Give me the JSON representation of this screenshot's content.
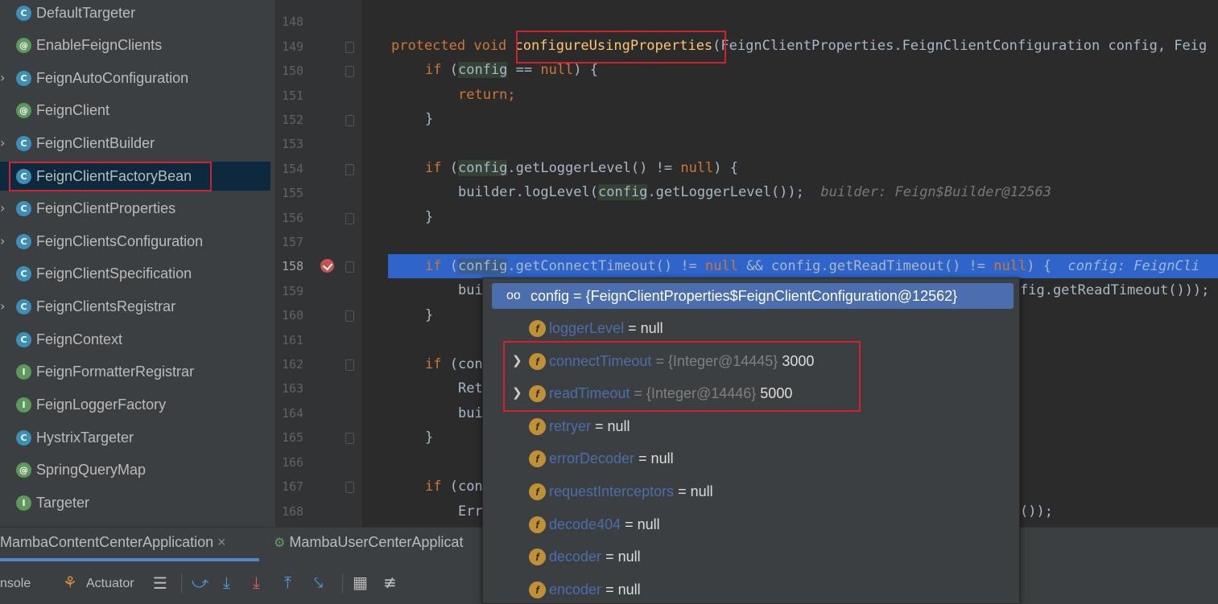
{
  "tree": {
    "items": [
      {
        "label": "DefaultTargeter",
        "icon": "c",
        "arrow": false
      },
      {
        "label": "EnableFeignClients",
        "icon": "@",
        "arrow": false
      },
      {
        "label": "FeignAutoConfiguration",
        "icon": "c",
        "arrow": true
      },
      {
        "label": "FeignClient",
        "icon": "@",
        "arrow": false
      },
      {
        "label": "FeignClientBuilder",
        "icon": "c",
        "arrow": true
      },
      {
        "label": "FeignClientFactoryBean",
        "icon": "c",
        "arrow": false,
        "selected": true
      },
      {
        "label": "FeignClientProperties",
        "icon": "c",
        "arrow": true
      },
      {
        "label": "FeignClientsConfiguration",
        "icon": "c",
        "arrow": true
      },
      {
        "label": "FeignClientSpecification",
        "icon": "c",
        "arrow": false
      },
      {
        "label": "FeignClientsRegistrar",
        "icon": "c",
        "arrow": true
      },
      {
        "label": "FeignContext",
        "icon": "c",
        "arrow": false
      },
      {
        "label": "FeignFormatterRegistrar",
        "icon": "I",
        "arrow": false
      },
      {
        "label": "FeignLoggerFactory",
        "icon": "I",
        "arrow": false
      },
      {
        "label": "HystrixTargeter",
        "icon": "c",
        "arrow": false
      },
      {
        "label": "SpringQueryMap",
        "icon": "@",
        "arrow": false
      },
      {
        "label": "Targeter",
        "icon": "I",
        "arrow": false
      }
    ]
  },
  "editor": {
    "line_numbers": [
      "148",
      "149",
      "150",
      "151",
      "152",
      "153",
      "154",
      "155",
      "156",
      "157",
      "158",
      "159",
      "160",
      "161",
      "162",
      "163",
      "164",
      "165",
      "166",
      "167",
      "168"
    ],
    "code": {
      "l149_kw": "protected void ",
      "l149_method": "configureUsingProperties",
      "l149_rest": "(FeignClientProperties.FeignClientConfiguration config, Feig",
      "l150_if": "if ",
      "l150_a": "(",
      "l150_var": "config",
      "l150_b": " == ",
      "l150_null": "null",
      "l150_c": ") {",
      "l151": "return;",
      "l152": "}",
      "l154_if": "if ",
      "l154_a": "(",
      "l154_var": "config",
      "l154_b": ".getLoggerLevel() != ",
      "l154_null": "null",
      "l154_c": ") {",
      "l155_a": "builder.logLevel(",
      "l155_var": "config",
      "l155_b": ".getLoggerLevel());",
      "l155_hint": "builder: Feign$Builder@12563",
      "l156": "}",
      "l158_if": "if ",
      "l158_a": "(",
      "l158_var": "config",
      "l158_b": ".getConnectTimeout() != ",
      "l158_null": "null",
      "l158_c": " && config.getReadTimeout() != ",
      "l158_null2": "null",
      "l158_d": ") {",
      "l158_hint": "config: FeignCli",
      "l159_a": "bui",
      "l159_b": "fig.getReadTimeout()));",
      "l160": "}",
      "l162_if": "if ",
      "l162_a": "(con",
      "l163": "Ret",
      "l164": "bui",
      "l165": "}",
      "l167_if": "if ",
      "l167_a": "(con",
      "l168_a": "Err",
      "l168_b": "());"
    }
  },
  "popup": {
    "header_name": "config",
    "header_eq": " = ",
    "header_value": "{FeignClientProperties$FeignClientConfiguration@12562}",
    "fields": [
      {
        "name": "loggerLevel",
        "value": " = null",
        "ref": "",
        "expandable": false
      },
      {
        "name": "connectTimeout",
        "value": " 3000",
        "ref": " = {Integer@14445}",
        "expandable": true
      },
      {
        "name": "readTimeout",
        "value": " 5000",
        "ref": " = {Integer@14446}",
        "expandable": true
      },
      {
        "name": "retryer",
        "value": " = null",
        "ref": "",
        "expandable": false
      },
      {
        "name": "errorDecoder",
        "value": " = null",
        "ref": "",
        "expandable": false
      },
      {
        "name": "requestInterceptors",
        "value": " = null",
        "ref": "",
        "expandable": false
      },
      {
        "name": "decode404",
        "value": " = null",
        "ref": "",
        "expandable": false
      },
      {
        "name": "decoder",
        "value": " = null",
        "ref": "",
        "expandable": false
      },
      {
        "name": "encoder",
        "value": " = null",
        "ref": "",
        "expandable": false
      }
    ]
  },
  "run_tabs": {
    "tab1": "MambaContentCenterApplication",
    "tab1_close": "×",
    "tab2": "MambaUserCenterApplicat"
  },
  "toolbar": {
    "console": "nsole",
    "actuator": "Actuator"
  },
  "colors": {
    "accent": "#2f65ca",
    "highlight_box": "#d3212d",
    "popup_header": "#4b6eaf"
  }
}
